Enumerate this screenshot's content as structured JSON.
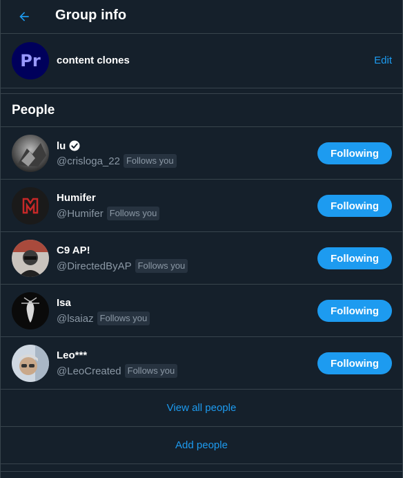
{
  "header": {
    "title": "Group info",
    "back_icon": "arrow-left-icon",
    "accent_color": "#1d9bf0"
  },
  "group": {
    "name": "content clones",
    "avatar_text": "Pr",
    "edit_label": "Edit"
  },
  "people_section": {
    "title": "People",
    "people": [
      {
        "name": "lu",
        "verified": true,
        "handle": "@crisloga_22",
        "badge": "Follows you",
        "button": "Following"
      },
      {
        "name": "Humifer",
        "verified": false,
        "handle": "@Humifer",
        "badge": "Follows you",
        "button": "Following"
      },
      {
        "name": "C9 AP!",
        "verified": false,
        "handle": "@DirectedByAP",
        "badge": "Follows you",
        "button": "Following"
      },
      {
        "name": "Isa",
        "verified": false,
        "handle": "@lsaiaz",
        "badge": "Follows you",
        "button": "Following"
      },
      {
        "name": "Leo***",
        "verified": false,
        "handle": "@LeoCreated",
        "badge": "Follows you",
        "button": "Following"
      }
    ],
    "view_all_label": "View all people",
    "add_people_label": "Add people"
  },
  "colors": {
    "background": "#15202b",
    "border": "#38444d",
    "secondary_text": "#8b98a5",
    "badge_bg": "#273340"
  }
}
